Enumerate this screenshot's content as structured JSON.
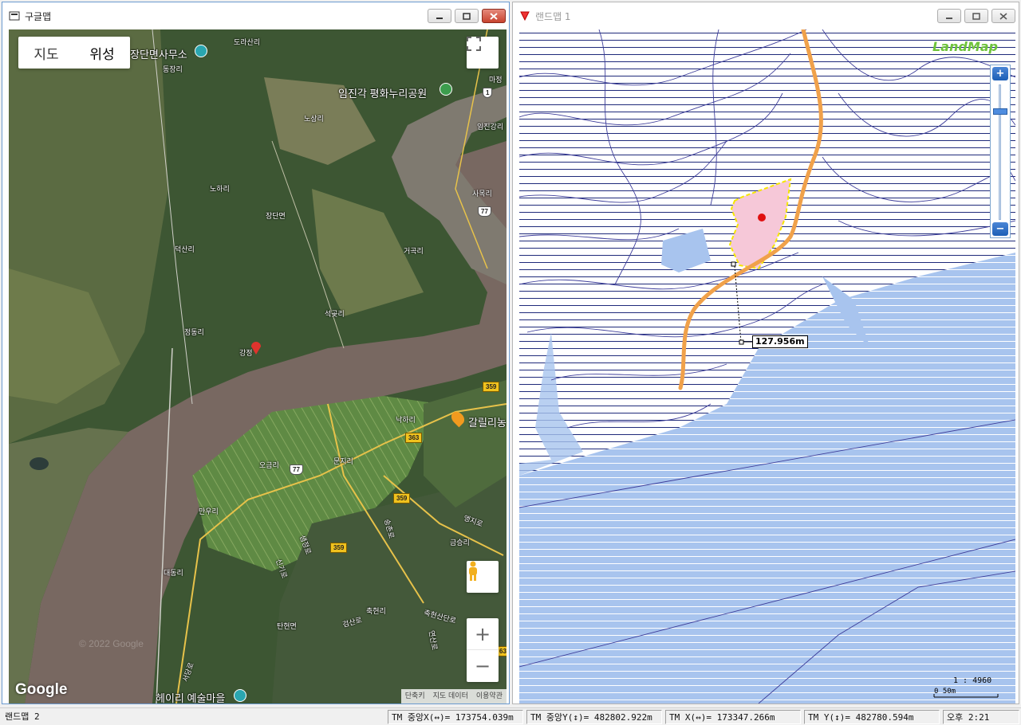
{
  "google_window": {
    "title": "구글맵",
    "map_type": {
      "map": "지도",
      "satellite": "위성",
      "selected": "satellite"
    },
    "icons": {
      "fullscreen": "fullscreen-icon",
      "pegman": "pegman-icon",
      "zoom_in": "+",
      "zoom_out": "−"
    },
    "logo": "Google",
    "copyright": "© 2022 Google",
    "footer": {
      "shortcuts": "단축키",
      "map_data": "지도 데이터",
      "terms": "이용약관"
    },
    "places": {
      "dorasan": "도라산리",
      "jangdan_office": "장단면사무소",
      "dongjang": "동장리",
      "majeong": "마정",
      "imjingak": "임진각 평화누리공원",
      "nosang": "노상리",
      "imjingang": "임진강리",
      "noha": "노하리",
      "sanok": "사목리",
      "jangdan": "장단면",
      "deoksan": "덕산리",
      "geoseok": "거곡리",
      "seokgot": "석곶리",
      "jeongdong": "정동리",
      "gangjeong": "강정",
      "nakha": "낙하리",
      "galil": "갈릴리농",
      "ogeum": "오금리",
      "munji": "문지리",
      "mane": "만우리",
      "saemjeong": "샘정로",
      "eungji": "엥지로",
      "geumseung": "금승리",
      "daedong": "대동리",
      "chukhyeon": "축현리",
      "chukhyeon_road": "축현산단로",
      "geomsan": "검산로",
      "tanhyeon": "탄현면",
      "heyri": "헤이리 예술마을",
      "seodang": "서당로",
      "singi": "신기로",
      "yeonsan": "연산로",
      "songchon": "송촌로"
    },
    "shields": {
      "r1": "1",
      "r77a": "77",
      "r77b": "77",
      "r359a": "359",
      "r359b": "359",
      "r359c": "359",
      "r363": "363",
      "r63": "63"
    },
    "colors": {
      "river": "#7a6a62",
      "forest": "#3e5a32",
      "field": "#6a8a48",
      "pin": "#e0332d"
    }
  },
  "landmap_window": {
    "title": "랜드맵 1",
    "logo": "LandMap",
    "measure_label": "127.956m",
    "scale_ratio": "1 : 4960",
    "scale_bar": "0   50m",
    "zoom": {
      "plus": "+",
      "minus": "−"
    },
    "colors": {
      "water": "#a8c4ee",
      "parcel_fill": "#f6c8d8",
      "parcel_border": "#f5e600",
      "road": "#f0a14a",
      "contour": "#3d3d9a",
      "hatch": "#1f2a7a",
      "point": "#e01010"
    }
  },
  "status_bar": {
    "app": "랜드맵 2",
    "tm_center_x": "TM 중앙X(↔)= 173754.039m",
    "tm_center_y": "TM 중앙Y(↕)= 482802.922m",
    "tm_x": "TM X(↔)= 173347.266m",
    "tm_y": "TM Y(↕)= 482780.594m",
    "time": "오후 2:21"
  }
}
